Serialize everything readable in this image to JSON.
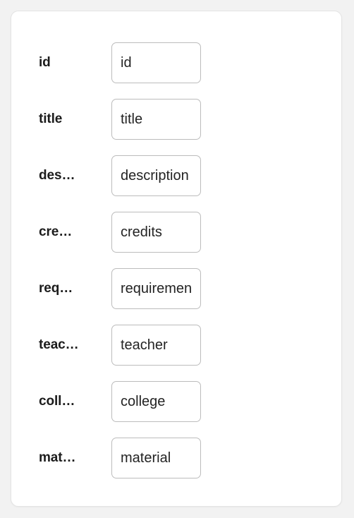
{
  "card": {
    "background_color": "#ffffff",
    "border_color": "#e3e3e3",
    "page_background_color": "#f2f2f2"
  },
  "form": {
    "fields": [
      {
        "label": "id",
        "label_display": "id",
        "value": "id",
        "value_display": "id"
      },
      {
        "label": "title",
        "label_display": "title",
        "value": "title",
        "value_display": "title"
      },
      {
        "label": "description",
        "label_display": "des…",
        "value": "description",
        "value_display": "descript"
      },
      {
        "label": "credits",
        "label_display": "cre…",
        "value": "credits",
        "value_display": "credits"
      },
      {
        "label": "requirements",
        "label_display": "req…",
        "value": "requirements",
        "value_display": "requiren"
      },
      {
        "label": "teacher",
        "label_display": "teac…",
        "value": "teacher",
        "value_display": "teacher"
      },
      {
        "label": "college",
        "label_display": "coll…",
        "value": "college",
        "value_display": "college"
      },
      {
        "label": "material",
        "label_display": "mat…",
        "value": "material",
        "value_display": "material"
      }
    ]
  }
}
